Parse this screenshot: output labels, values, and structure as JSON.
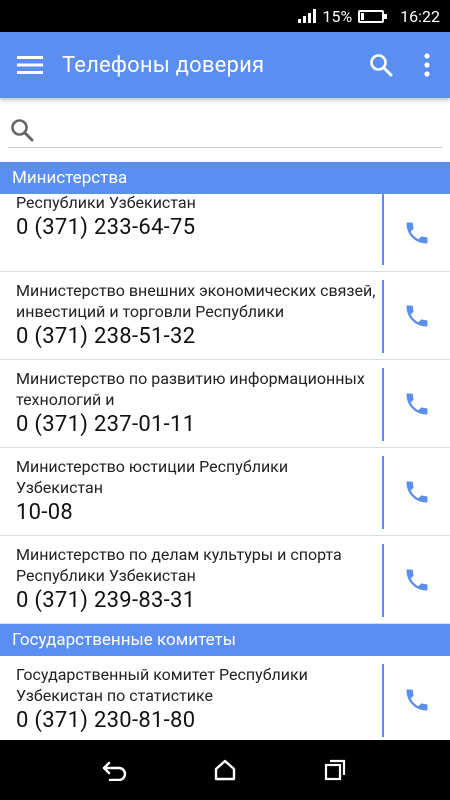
{
  "status_bar": {
    "battery_percent": "15%",
    "battery_level": 0.15,
    "time": "16:22"
  },
  "app_bar": {
    "title": "Телефоны доверия",
    "icons": [
      "menu-icon",
      "search-icon",
      "more-vert-icon"
    ]
  },
  "search": {
    "value": "",
    "placeholder": ""
  },
  "sections": [
    {
      "header": "Министерства",
      "items": [
        {
          "name": "Республики Узбекистан",
          "phone": "0 (371) 233-64-75"
        },
        {
          "name": "Министерство внешних экономических связей, инвестиций и торговли Республики",
          "phone": "0 (371) 238-51-32"
        },
        {
          "name": "Министерство по развитию информационных технологий и",
          "phone": "0 (371) 237-01-11"
        },
        {
          "name": "Министерство юстиции Республики Узбекистан",
          "phone": "10-08"
        },
        {
          "name": "Министерство по делам культуры и спорта Республики Узбекистан",
          "phone": "0 (371) 239-83-31"
        }
      ]
    },
    {
      "header": "Государственные комитеты",
      "items": [
        {
          "name": "Государственный комитет Республики Узбекистан по статистике",
          "phone": "0 (371) 230-81-80"
        }
      ]
    }
  ],
  "colors": {
    "accent": "#5a8ef0",
    "status_bar": "#000000",
    "nav_bar": "#000000"
  },
  "nav_bar": {
    "icons": [
      "back-icon",
      "home-icon",
      "recents-icon"
    ]
  }
}
